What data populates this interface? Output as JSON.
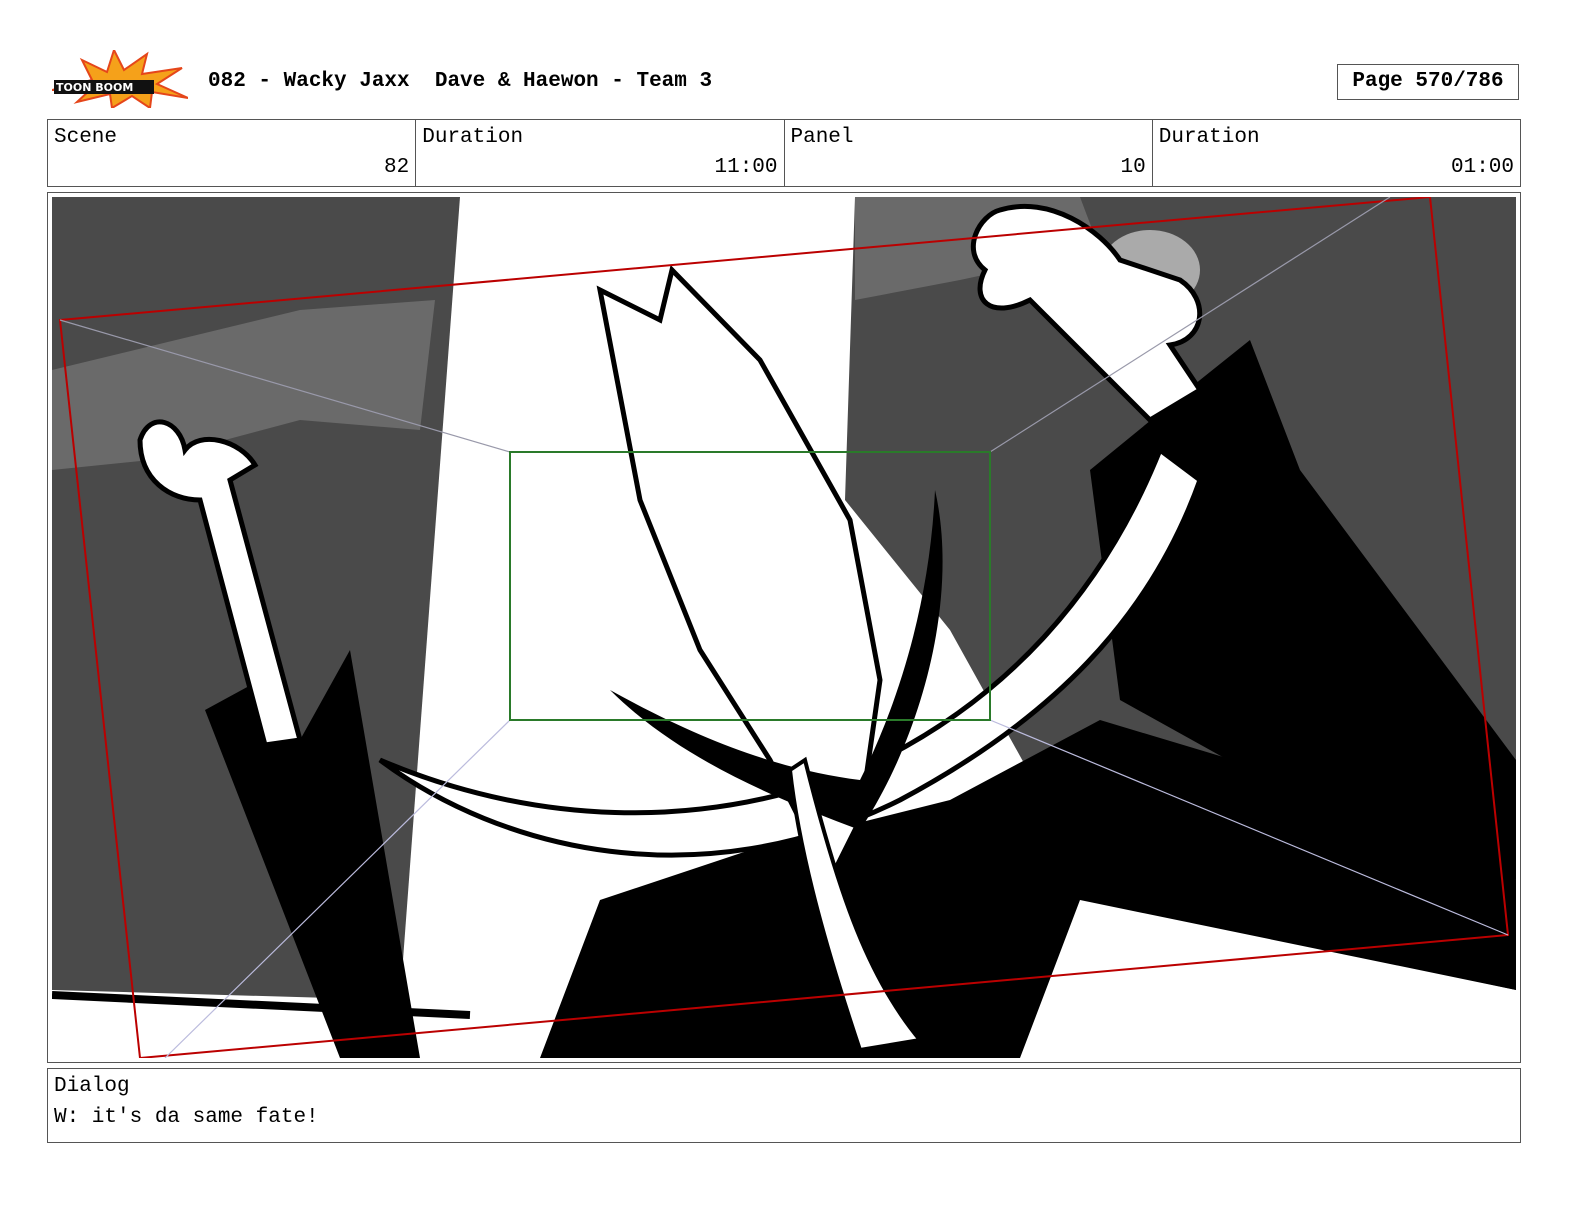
{
  "header": {
    "logo_text": "TOON BOOM",
    "title": "082 - Wacky Jaxx  Dave & Haewon - Team 3",
    "page": "Page 570/786"
  },
  "info": {
    "scene_label": "Scene",
    "scene_value": "82",
    "scene_duration_label": "Duration",
    "scene_duration_value": "11:00",
    "panel_label": "Panel",
    "panel_value": "10",
    "panel_duration_label": "Duration",
    "panel_duration_value": "01:00"
  },
  "dialog": {
    "label": "Dialog",
    "text": "W: it's da same fate!"
  }
}
